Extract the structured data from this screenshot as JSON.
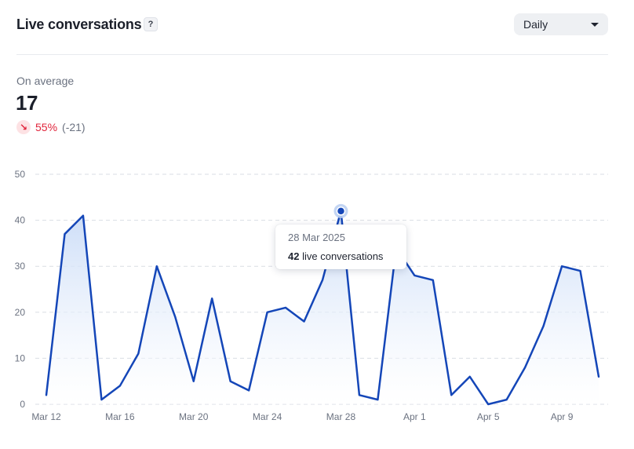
{
  "header": {
    "title": "Live conversations",
    "help_label": "?",
    "granularity": "Daily"
  },
  "summary": {
    "label": "On average",
    "value": "17",
    "change_icon": "arrow-down-right-icon",
    "change_pct": "55%",
    "change_abs": "(-21)"
  },
  "tooltip": {
    "date": "28 Mar 2025",
    "value": "42",
    "unit": "live conversations"
  },
  "colors": {
    "line": "#1446b8",
    "fill_top": "#c9dbf7",
    "grid": "#d9dde4",
    "axis_text": "#6b7280",
    "negative": "#e0243b"
  },
  "chart_data": {
    "type": "area",
    "x": [
      "Mar 12",
      "Mar 13",
      "Mar 14",
      "Mar 15",
      "Mar 16",
      "Mar 17",
      "Mar 18",
      "Mar 19",
      "Mar 20",
      "Mar 21",
      "Mar 22",
      "Mar 23",
      "Mar 24",
      "Mar 25",
      "Mar 26",
      "Mar 27",
      "Mar 28",
      "Mar 29",
      "Mar 30",
      "Mar 31",
      "Apr 1",
      "Apr 2",
      "Apr 3",
      "Apr 4",
      "Apr 5",
      "Apr 6",
      "Apr 7",
      "Apr 8",
      "Apr 9",
      "Apr 10",
      "Apr 11"
    ],
    "series": [
      {
        "values": [
          2,
          37,
          41,
          1,
          4,
          11,
          30,
          19,
          5,
          23,
          5,
          3,
          20,
          21,
          18,
          27,
          42,
          2,
          1,
          34,
          28,
          27,
          2,
          6,
          0,
          1,
          8,
          17,
          30,
          29,
          6
        ]
      }
    ],
    "xticks": [
      "Mar 12",
      "Mar 16",
      "Mar 20",
      "Mar 24",
      "Mar 28",
      "Apr 1",
      "Apr 5",
      "Apr 9"
    ],
    "yticks": [
      0,
      10,
      20,
      30,
      40,
      50
    ],
    "ylim": [
      0,
      50
    ],
    "grid": true,
    "highlight": {
      "x": "Mar 28",
      "value": 42
    }
  }
}
